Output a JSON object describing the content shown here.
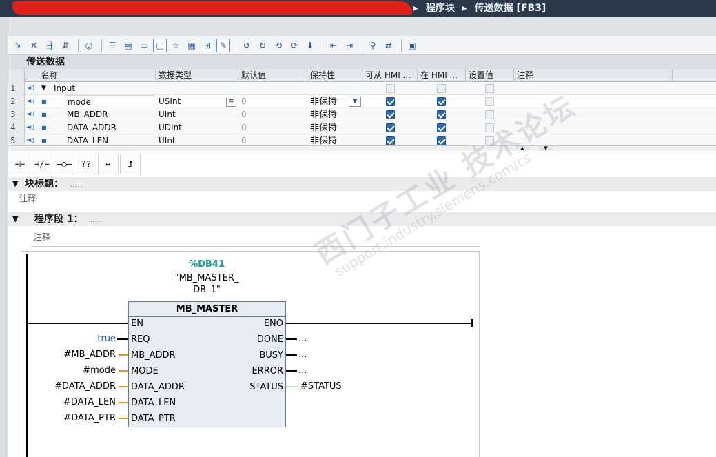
{
  "breadcrumb": {
    "sep": "▸",
    "item1": "程序块",
    "item2": "传送数据 [FB3]"
  },
  "interface": {
    "title": "传送数据",
    "columns": {
      "name": "名称",
      "datatype": "数据类型",
      "default": "默认值",
      "retain": "保持性",
      "hmi_access": "可从 HMI ...",
      "hmi_visible": "在 HMI ...",
      "setpoint": "设置值",
      "comment": "注释"
    },
    "rows": [
      {
        "num": "1",
        "name": "Input",
        "type": "",
        "default": "",
        "retain": "",
        "hmi_access": null,
        "hmi_visible": null,
        "setpoint": false
      },
      {
        "num": "2",
        "name": "mode",
        "type": "USInt",
        "default": "0",
        "retain": "非保持",
        "hmi_access": true,
        "hmi_visible": true,
        "setpoint": false
      },
      {
        "num": "3",
        "name": "MB_ADDR",
        "type": "UInt",
        "default": "0",
        "retain": "非保持",
        "hmi_access": true,
        "hmi_visible": true,
        "setpoint": false
      },
      {
        "num": "4",
        "name": "DATA_ADDR",
        "type": "UDInt",
        "default": "0",
        "retain": "非保持",
        "hmi_access": true,
        "hmi_visible": true,
        "setpoint": false
      },
      {
        "num": "5",
        "name": "DATA_LEN",
        "type": "UInt",
        "default": "0",
        "retain": "非保持",
        "hmi_access": true,
        "hmi_visible": true,
        "setpoint": false
      }
    ]
  },
  "ladder_toolbar": {
    "no_contact": "⊣⊢",
    "nc_contact": "⊣/⊢",
    "coil": "—○—",
    "box": "??",
    "branch_open": "↦",
    "branch_close": "⮥"
  },
  "block_title": {
    "label": "块标题：",
    "dots": ".....",
    "comment": "注释"
  },
  "network1": {
    "label": "程序段 1：",
    "dots": ".....",
    "comment": "注释"
  },
  "fb_call": {
    "db_number": "%DB41",
    "db_name_line1": "\"MB_MASTER_",
    "db_name_line2": "DB_1\"",
    "block_name": "MB_MASTER",
    "inputs": [
      "EN",
      "REQ",
      "MB_ADDR",
      "MODE",
      "DATA_ADDR",
      "DATA_LEN",
      "DATA_PTR"
    ],
    "outputs": [
      "ENO",
      "DONE",
      "BUSY",
      "ERROR",
      "STATUS"
    ],
    "input_args": {
      "REQ": "true",
      "MB_ADDR": "#MB_ADDR",
      "MODE": "#mode",
      "DATA_ADDR": "#DATA_ADDR",
      "DATA_LEN": "#DATA_LEN",
      "DATA_PTR": "#DATA_PTR"
    },
    "output_args": {
      "DONE": "...",
      "BUSY": "...",
      "ERROR": "...",
      "STATUS": "#STATUS"
    }
  },
  "watermark": {
    "line1": "西门子工业 技术论坛",
    "line2": "support.industry.siemens.com/cs"
  },
  "colors": {
    "checked": "#2b6cb0",
    "dbnumber": "#1d9b9b",
    "param_wire": "#e59a16"
  }
}
